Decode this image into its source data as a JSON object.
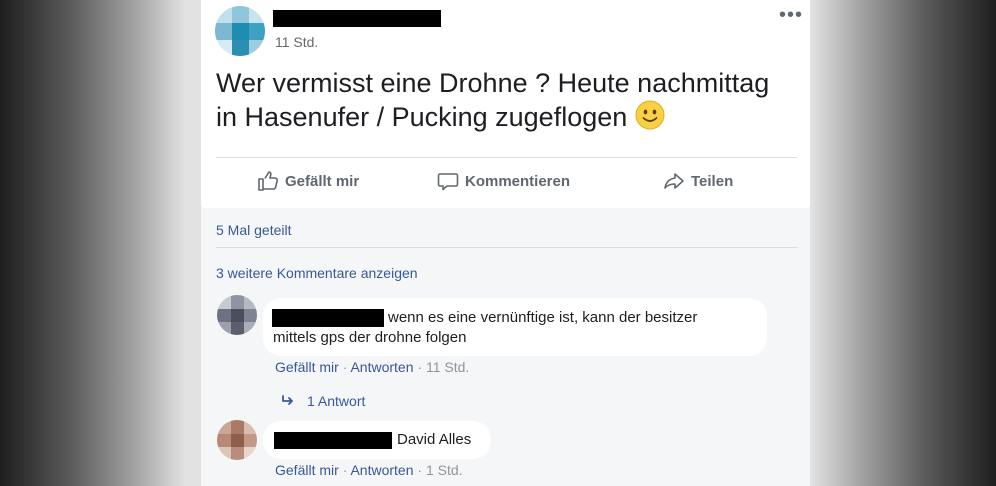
{
  "post": {
    "time": "11 Std.",
    "more_label": "•••",
    "text": "Wer vermisst eine Drohne ? Heute nachmittag in Hasenufer / Pucking zugeflogen",
    "emoji": "slightly-smiling-face-icon"
  },
  "actions": {
    "like": "Gefällt mir",
    "comment": "Kommentieren",
    "share": "Teilen"
  },
  "shares": "5 Mal geteilt",
  "more_comments": "3 weitere Kommentare anzeigen",
  "comments": [
    {
      "text": "wenn es eine vernünftige ist, kann der besitzer mittels gps der drohne folgen",
      "like": "Gefällt mir",
      "reply": "Antworten",
      "time": "11 Std.",
      "replies_link": "1 Antwort"
    },
    {
      "text": "David Alles",
      "like": "Gefällt mir",
      "reply": "Antworten",
      "time": "1 Std."
    }
  ],
  "colors": {
    "link": "#385898",
    "text": "#1c1e21",
    "meta": "#65676b",
    "redaction": "#000000"
  }
}
